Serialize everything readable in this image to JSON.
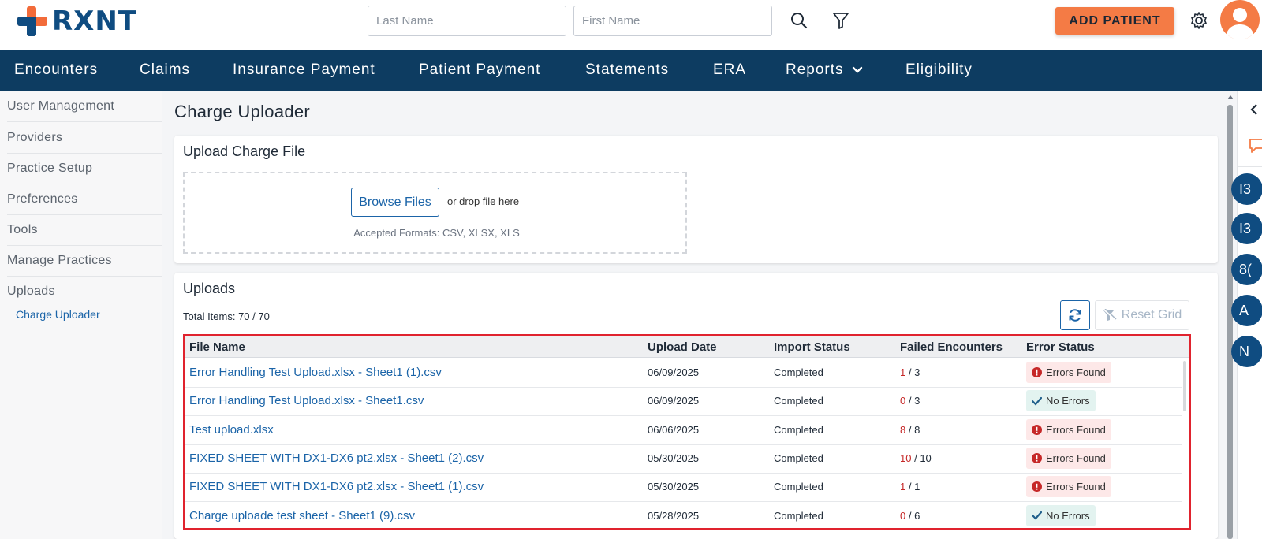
{
  "brand": {
    "name": "RXNT"
  },
  "search": {
    "last_name_placeholder": "Last Name",
    "first_name_placeholder": "First Name"
  },
  "header": {
    "add_patient_label": "ADD PATIENT"
  },
  "nav": {
    "items": [
      "Encounters",
      "Claims",
      "Insurance Payment",
      "Patient Payment",
      "Statements",
      "ERA",
      "Reports",
      "Eligibility"
    ]
  },
  "sidebar": {
    "items": [
      "User Management",
      "Providers",
      "Practice Setup",
      "Preferences",
      "Tools",
      "Manage Practices",
      "Uploads"
    ],
    "sub_item": "Charge Uploader"
  },
  "main": {
    "title": "Charge Uploader",
    "upload_card": {
      "title": "Upload Charge File",
      "browse_label": "Browse Files",
      "drop_text": "or drop file here",
      "formats": "Accepted Formats: CSV, XLSX, XLS"
    },
    "uploads_card": {
      "title": "Uploads",
      "total": "Total Items: 70 / 70",
      "reset_label": "Reset Grid",
      "columns": [
        "File Name",
        "Upload Date",
        "Import Status",
        "Failed Encounters",
        "Error Status"
      ],
      "rows": [
        {
          "file": "Error Handling Test Upload.xlsx - Sheet1 (1).csv",
          "date": "06/09/2025",
          "status": "Completed",
          "failed": "1",
          "total": "/ 3",
          "error": "Errors Found"
        },
        {
          "file": "Error Handling Test Upload.xlsx - Sheet1.csv",
          "date": "06/09/2025",
          "status": "Completed",
          "failed": "0",
          "total": "/ 3",
          "error": "No Errors"
        },
        {
          "file": "Test upload.xlsx",
          "date": "06/06/2025",
          "status": "Completed",
          "failed": "8",
          "total": "/ 8",
          "error": "Errors Found"
        },
        {
          "file": "FIXED SHEET WITH DX1-DX6 pt2.xlsx - Sheet1 (2).csv",
          "date": "05/30/2025",
          "status": "Completed",
          "failed": "10",
          "total": "/ 10",
          "error": "Errors Found"
        },
        {
          "file": "FIXED SHEET WITH DX1-DX6 pt2.xlsx - Sheet1 (1).csv",
          "date": "05/30/2025",
          "status": "Completed",
          "failed": "1",
          "total": "/ 1",
          "error": "Errors Found"
        },
        {
          "file": "Charge uploade test sheet - Sheet1 (9).csv",
          "date": "05/28/2025",
          "status": "Completed",
          "failed": "0",
          "total": "/ 6",
          "error": "No Errors"
        }
      ]
    }
  },
  "right_rail": {
    "circles": [
      "I3",
      "I3",
      "8(",
      "A",
      "N"
    ]
  },
  "colors": {
    "brand_navy": "#0d3c61",
    "accent_orange": "#f47b45",
    "link_blue": "#1b64a8",
    "highlight_red": "#e0232e"
  }
}
